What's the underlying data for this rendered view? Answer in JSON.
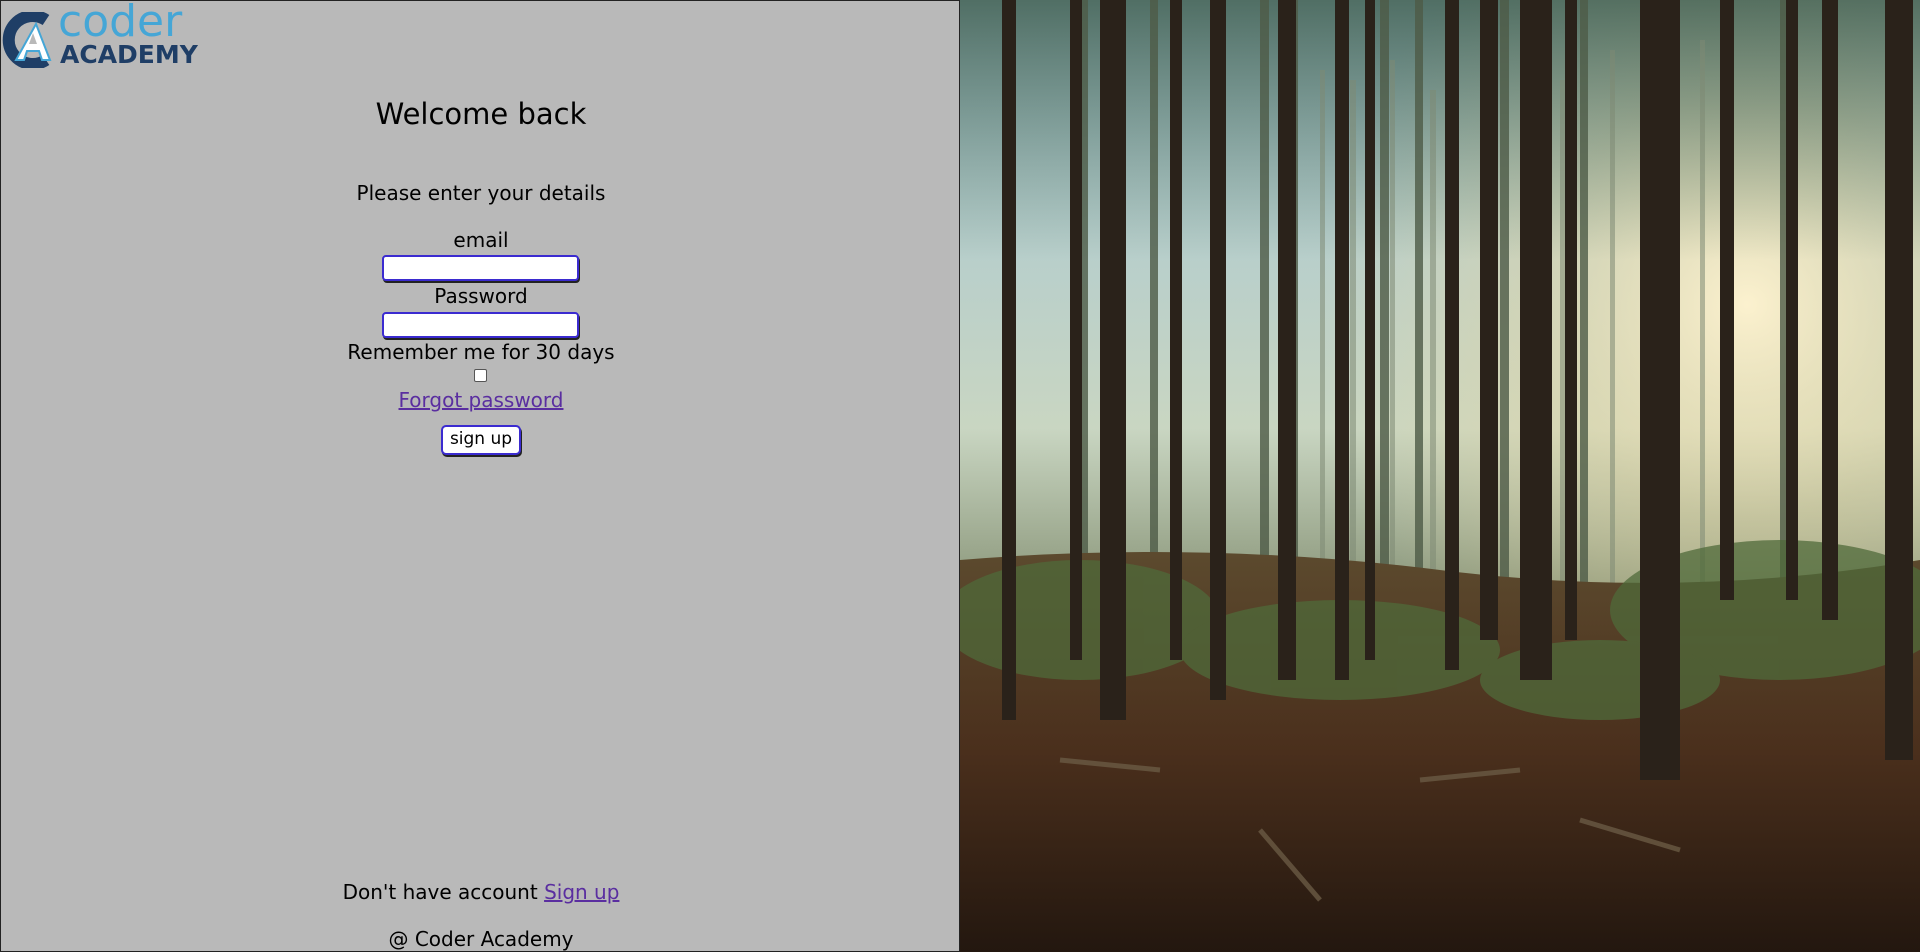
{
  "logo": {
    "word1": "coder",
    "word2": "ACADEMY",
    "letter": "A",
    "icon": "coder-academy-logo-icon"
  },
  "login": {
    "title": "Welcome back",
    "subtitle": "Please enter your details",
    "email_label": "email",
    "email_value": "",
    "password_label": "Password",
    "password_value": "",
    "remember_label": "Remember me for 30 days",
    "remember_checked": false,
    "forgot_link": "Forgot password",
    "submit_label": "sign up"
  },
  "footer": {
    "no_account_text": "Don't have account",
    "signup_link": "Sign up",
    "copyright": "@ Coder Academy"
  },
  "image": {
    "subject": "forest-photo"
  },
  "colors": {
    "panel_bg": "#b9b9b9",
    "link": "#5a2ea0",
    "input_border": "#3b2bd0",
    "logo_blue": "#45a6d6",
    "logo_navy": "#1f3e66"
  }
}
